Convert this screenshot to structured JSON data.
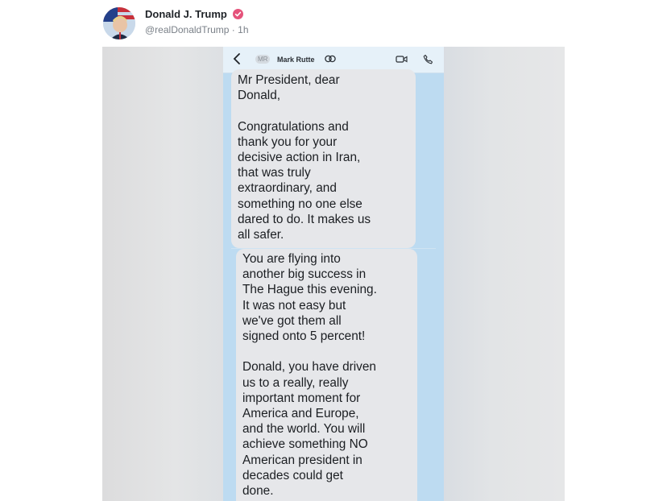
{
  "post": {
    "display_name": "Donald J. Trump",
    "handle": "@realDonaldTrump",
    "separator": "·",
    "time": "1h",
    "avatar_icon": "flag-portrait-avatar",
    "verified_icon": "verified-badge-icon",
    "verified_color": "#e5537b"
  },
  "screenshot": {
    "contact_initials": "MR",
    "contact_name": "Mark Rutte",
    "icons": [
      "back-chevron-icon",
      "group-icon",
      "video-call-icon",
      "phone-call-icon"
    ],
    "messages": [
      {
        "text": "Mr President, dear\nDonald,\n\nCongratulations and\nthank you for your\ndecisive action in Iran,\nthat was truly\nextraordinary, and\nsomething no one else\ndared to do.  It makes us\nall safer."
      },
      {
        "text": "You are flying into\nanother big success in\nThe Hague this evening.\nIt was not easy but\nwe've got them all\nsigned onto 5 percent!\n\nDonald, you have driven\nus to a really, really\nimportant moment for\nAmerica and Europe,\nand the world.  You will\nachieve something NO\nAmerican president in\ndecades could get\ndone."
      }
    ],
    "bubble_color": "#e6e7ea",
    "chat_background": "#bddbf1"
  }
}
